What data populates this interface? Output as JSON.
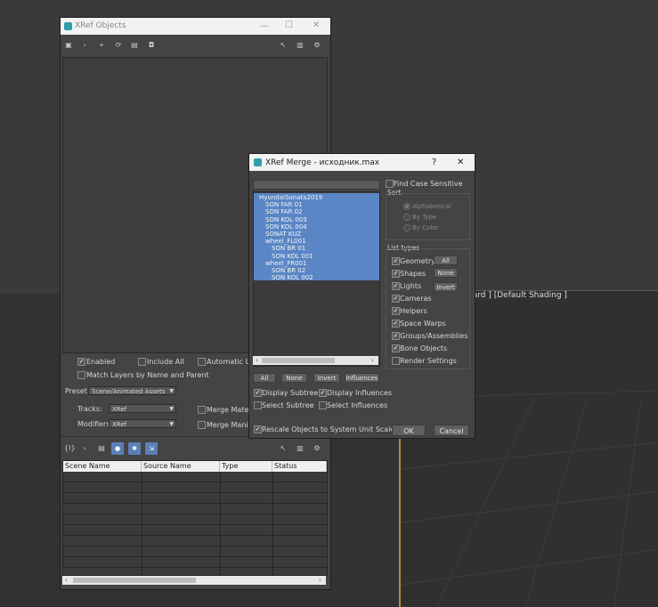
{
  "viewport": {
    "label": "dard ] [Default Shading ]"
  },
  "xref_objects": {
    "title": "XRef Objects",
    "window_buttons": {
      "minimize": "—",
      "maximize": "☐",
      "close": "✕"
    },
    "options": {
      "enabled": "Enabled",
      "include_all": "Include All",
      "automatic_update": "Automatic Upda",
      "match_layers": "Match Layers by Name and Parent",
      "preset_label": "Preset:",
      "preset_value": "Scene/Animated Assets",
      "tracks_label": "Tracks:",
      "tracks_value": "XRef",
      "modifiers_label": "Modifiers:",
      "modifiers_value": "XRef",
      "merge_materials": "Merge Materials",
      "merge_manipulators": "Merge Manipula"
    },
    "bottom_toolbar_first": "{I}",
    "table_headers": [
      "Scene Name",
      "Source Name",
      "Type",
      "Status"
    ]
  },
  "xref_merge": {
    "title": "XRef Merge - исходник.max",
    "help": "?",
    "close": "✕",
    "tree_items": [
      {
        "label": "HyundaiSonata2019",
        "level": 0
      },
      {
        "label": "SON FAR 01",
        "level": 1
      },
      {
        "label": "SON FAR 02",
        "level": 1
      },
      {
        "label": "SON KOL 003",
        "level": 1
      },
      {
        "label": "SON KOL 004",
        "level": 1
      },
      {
        "label": "SONAT KUZ",
        "level": 1
      },
      {
        "label": "wheel_FL001",
        "level": 1
      },
      {
        "label": "SON BR 01",
        "level": 2
      },
      {
        "label": "SON KOL 001",
        "level": 2
      },
      {
        "label": "wheel_FR001",
        "level": 1
      },
      {
        "label": "SON BR 02",
        "level": 2
      },
      {
        "label": "SON KOL 002",
        "level": 2
      }
    ],
    "find_case_sensitive": "Find Case Sensitive",
    "sort": {
      "title": "Sort",
      "alphabetical": "Alphabetical",
      "by_type": "By Type",
      "by_color": "By Color"
    },
    "list_types": {
      "title": "List types",
      "geometry": "Geometry",
      "shapes": "Shapes",
      "lights": "Lights",
      "cameras": "Cameras",
      "helpers": "Helpers",
      "space_warps": "Space Warps",
      "groups": "Groups/Assemblies",
      "bone_objects": "Bone Objects",
      "render_settings": "Render Settings",
      "all_btn": "All",
      "none_btn": "None",
      "invert_btn": "Invert"
    },
    "buttons": {
      "all": "All",
      "none": "None",
      "invert": "Invert",
      "influences": "Influences"
    },
    "display_subtree": "Display Subtree",
    "display_influences": "Display Influences",
    "select_subtree": "Select Subtree",
    "select_influences": "Select Influences",
    "rescale": "Rescale Objects to System Unit Scale",
    "ok": "OK",
    "cancel": "Cancel"
  }
}
